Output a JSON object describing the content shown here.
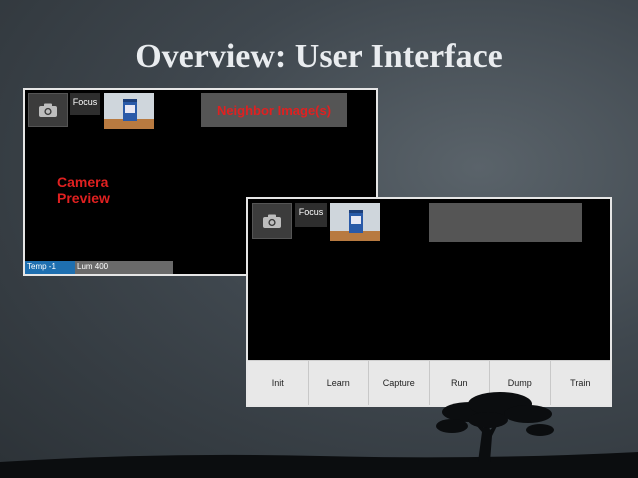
{
  "slide": {
    "title": "Overview: User Interface"
  },
  "screen_top": {
    "camera_icon": "camera-icon",
    "focus_label": "Focus",
    "neighbor_label": "Neighbor Image(s)",
    "preview_label_line1": "Camera",
    "preview_label_line2": "Preview",
    "status_temp": "Temp -1",
    "status_lum": "Lum 400"
  },
  "screen_bottom": {
    "camera_icon": "camera-icon",
    "focus_label": "Focus",
    "toolbar": [
      {
        "label": "Init"
      },
      {
        "label": "Learn"
      },
      {
        "label": "Capture"
      },
      {
        "label": "Run"
      },
      {
        "label": "Dump"
      },
      {
        "label": "Train"
      }
    ]
  },
  "colors": {
    "accent_red": "#e02020",
    "status_blue": "#1e6fb0"
  }
}
